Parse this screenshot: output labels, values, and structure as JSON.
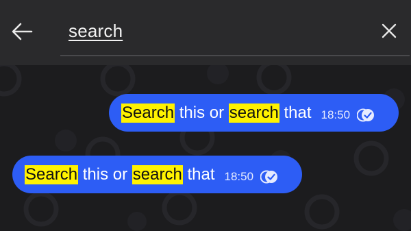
{
  "search": {
    "query": "search"
  },
  "messages": [
    {
      "highlight_1": "Search",
      "text_1": " this or ",
      "highlight_2": "search",
      "text_2": " that",
      "time": "18:50",
      "status_icon": "double-check-delivered-icon"
    },
    {
      "highlight_1": "Search",
      "text_1": " this or ",
      "highlight_2": "search",
      "text_2": " that",
      "time": "18:50",
      "status_icon": "double-check-delivered-icon"
    }
  ],
  "colors": {
    "bubble": "#2d5df5",
    "highlight": "#fff200",
    "topbar": "#2a2a2c",
    "chat_background": "#1c1c1e"
  }
}
